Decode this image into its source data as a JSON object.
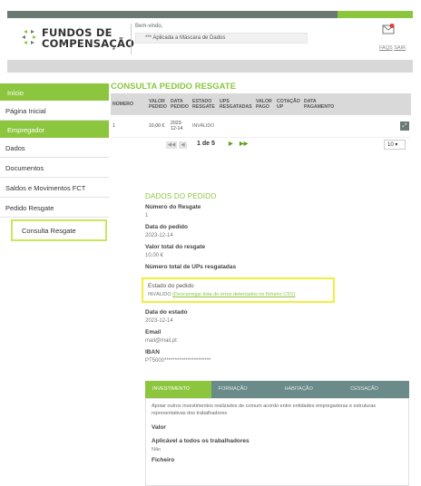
{
  "header": {
    "logo_line1": "FUNDOS DE",
    "logo_line2": "COMPENSAÇÃO",
    "welcome": "Bem-vindo,",
    "mask_text": "*** Aplicada a Máscara de Dados",
    "link_left": "FAQS",
    "link_right": "SAIR"
  },
  "sidebar": {
    "section_inicio": "Início",
    "item_pagina_inicial": "Página Inicial",
    "section_empregador": "Empregador",
    "items": [
      "Dados",
      "Documentos",
      "Saldos e Movimentos FCT",
      "Pedido Resgate",
      "Consulta Resgate"
    ]
  },
  "main": {
    "title": "CONSULTA PEDIDO RESGATE",
    "columns": [
      "NÚMERO",
      "VALOR PEDIDO",
      "DATA PEDIDO",
      "ESTADO RESGATE",
      "UPS RESGATADAS",
      "VALOR PAGO",
      "COTAÇÃO UP",
      "DATA PAGAMENTO"
    ],
    "row": {
      "numero": "1",
      "valor": "10,00 €",
      "data": "2023-12-14",
      "estado": "INVÁLIDO"
    },
    "pager": {
      "first": "◀◀",
      "prev": "◀",
      "info": "1 de 5",
      "next": "▶",
      "last": "▶▶",
      "per_page": "10 ▾"
    }
  },
  "details": {
    "title": "DADOS DO PEDIDO",
    "numero_label": "Número do Resgate",
    "numero_value": "1",
    "data_label": "Data do pedido",
    "data_value": "2023-12-14",
    "valor_label": "Valor total do resgate",
    "valor_value": "10,00 €",
    "ups_label": "Número total de UPs resgatadas",
    "estado_label": "Estado do pedido",
    "estado_value": "INVÁLIDO",
    "estado_link": "(Descarregar lista de erros detectados no ficheiro CSV)",
    "data_estado_label": "Data do estado",
    "data_estado_value": "2023-12-14",
    "email_label": "Email",
    "email_value": "mail@mail.pt",
    "iban_label": "IBAN",
    "iban_value": "PT5000**********************"
  },
  "tabs": [
    "INVESTIMENTO",
    "FORMAÇÃO",
    "HABITAÇÃO",
    "CESSAÇÃO"
  ],
  "tabpanel": {
    "description": "Apoiar outros investimentos realizados de comum acordo entre entidades empregadoras e estruturas representativas dos trabalhadores",
    "valor_label": "Valor",
    "aplicavel_label": "Aplicável a todos os trabalhadores",
    "aplicavel_value": "Não",
    "ficheiro_label": "Ficheiro"
  },
  "colors": {
    "accent": "#8cc63f",
    "dark": "#6a7a72",
    "highlight": "#f0ef3b"
  }
}
